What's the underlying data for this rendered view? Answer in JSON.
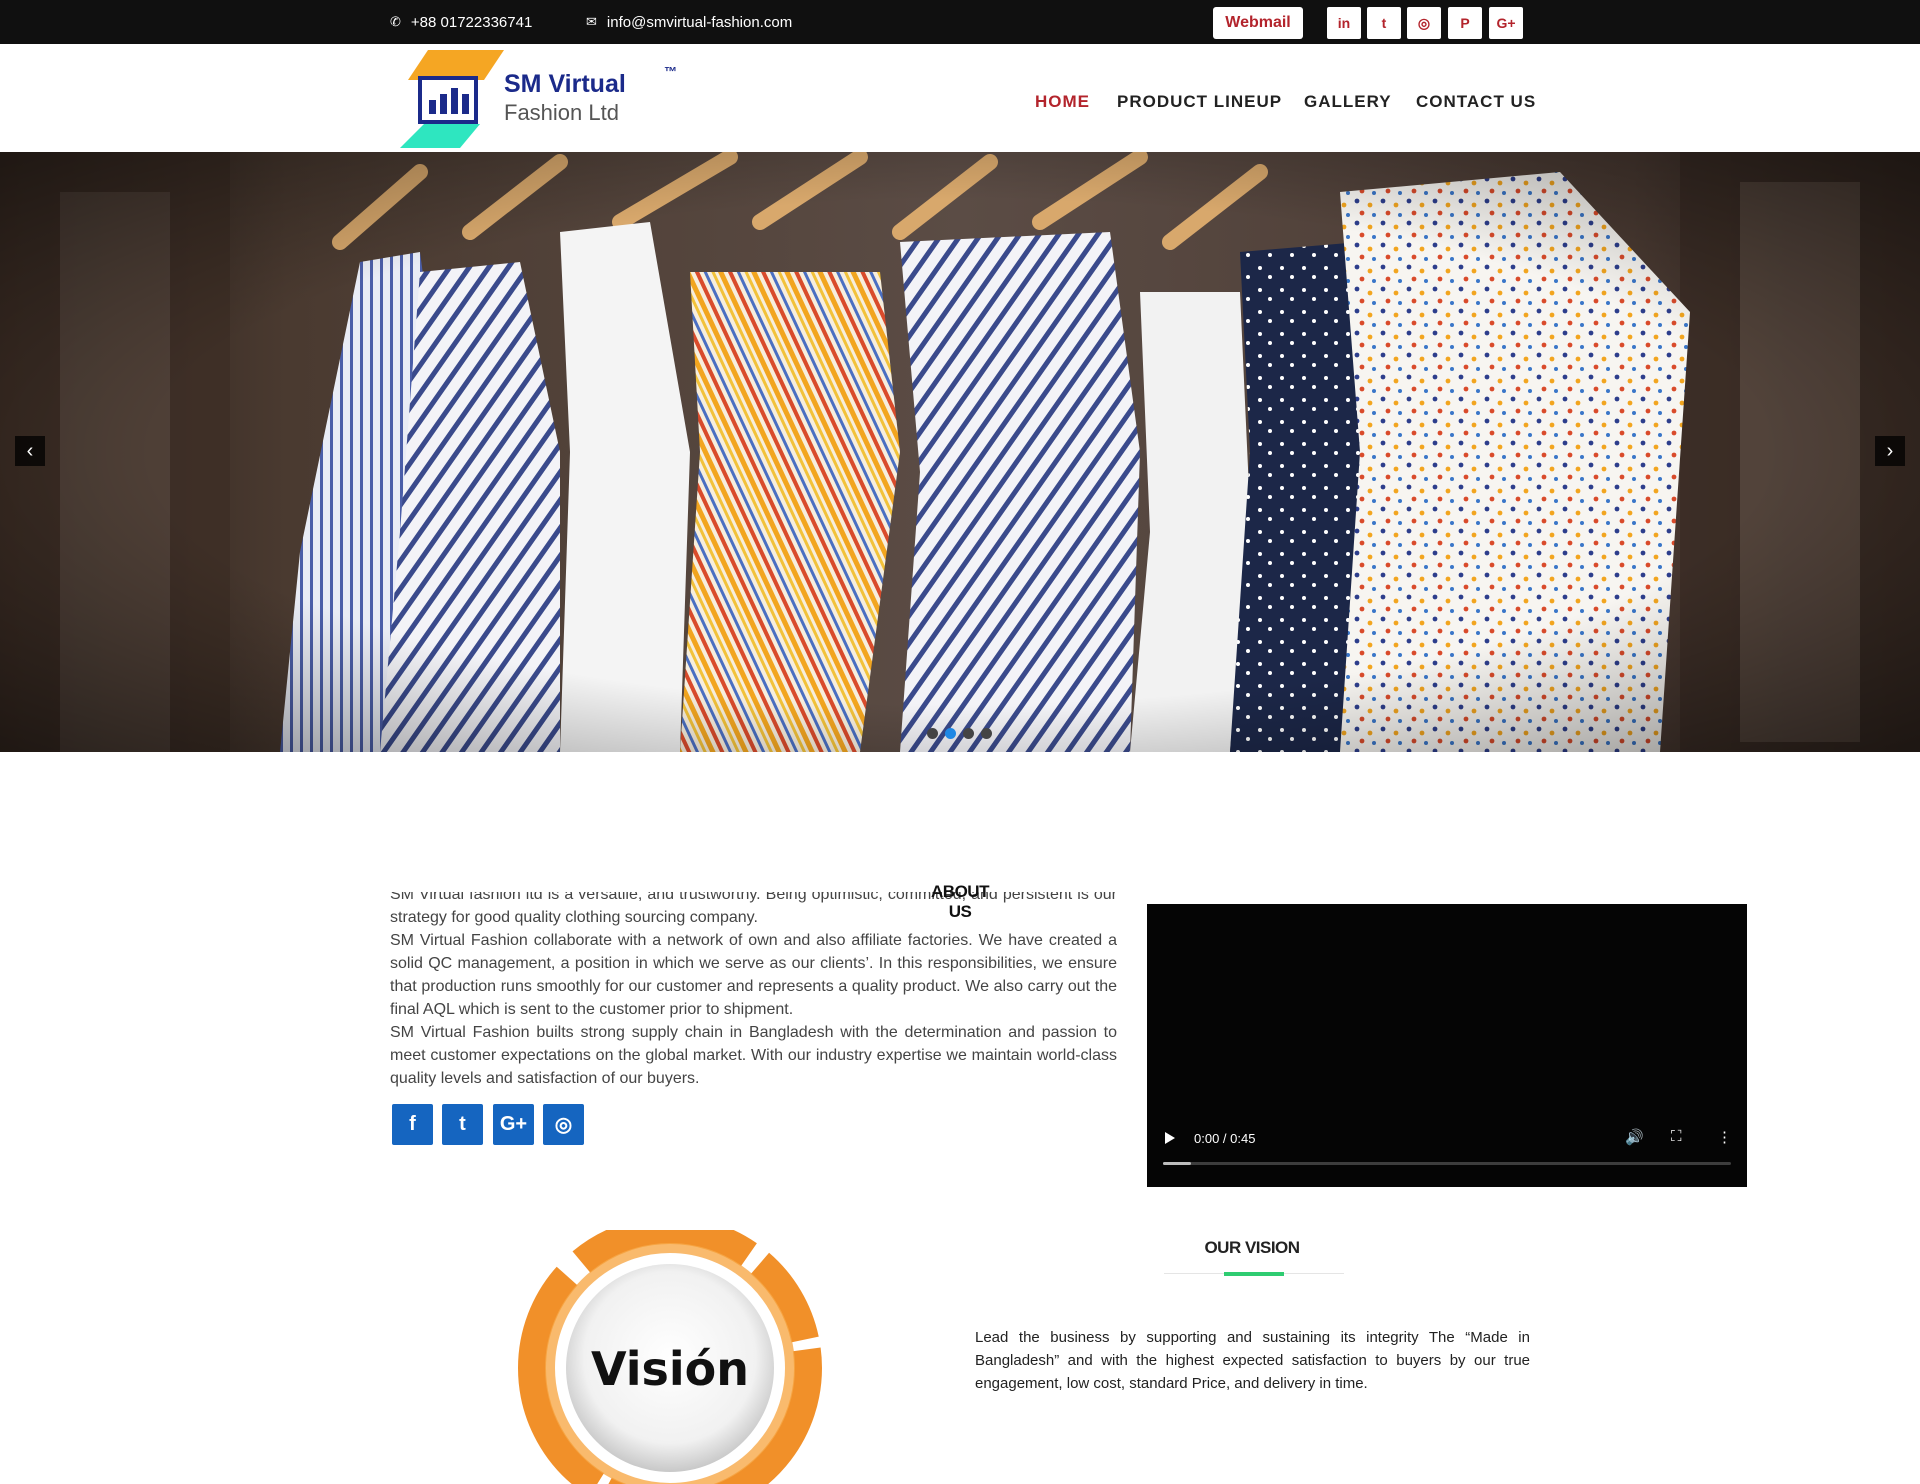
{
  "topbar": {
    "phone": "+88 01722336741",
    "email": "info@smvirtual-fashion.com",
    "webmail_label": "Webmail",
    "social": [
      {
        "name": "linkedin-icon",
        "glyph": "in"
      },
      {
        "name": "twitter-icon",
        "glyph": "t"
      },
      {
        "name": "instagram-icon",
        "glyph": "◎"
      },
      {
        "name": "pinterest-icon",
        "glyph": "P"
      },
      {
        "name": "google-plus-icon",
        "glyph": "G+"
      }
    ]
  },
  "logo": {
    "line1": "SM Virtual",
    "line2": "Fashion Ltd",
    "tm": "™"
  },
  "nav": [
    {
      "label": "HOME",
      "active": true
    },
    {
      "label": "PRODUCT LINEUP",
      "active": false
    },
    {
      "label": "GALLERY",
      "active": false
    },
    {
      "label": "CONTACT US",
      "active": false
    }
  ],
  "slider": {
    "prev": "‹",
    "next": "›",
    "dots": 4,
    "active_dot": 2
  },
  "about": {
    "title": "ABOUT US",
    "paragraphs": [
      "SM Virtual fashion ltd is a versatile, and trustworthy. Being optimistic, committed, and persistent is our strategy for good quality clothing sourcing company.",
      "SM Virtual Fashion collaborate with a network of own and also affiliate factories. We have created a solid QC management, a position in which we serve as our clients’. In this responsibilities, we ensure that production runs smoothly for our customer and represents a quality product. We also carry out the final AQL which is sent to the customer prior to shipment.",
      "SM Virtual Fashion builts strong supply chain in Bangladesh with the determination and passion to meet customer expectations on the global market. With our industry expertise we maintain world-class quality levels and satisfaction of our buyers."
    ],
    "social": [
      {
        "name": "facebook-icon",
        "glyph": "f"
      },
      {
        "name": "twitter-icon",
        "glyph": "t"
      },
      {
        "name": "google-plus-icon",
        "glyph": "G+"
      },
      {
        "name": "instagram-icon",
        "glyph": "◎"
      }
    ]
  },
  "video": {
    "time": "0:00 / 0:45",
    "progress": 0.05
  },
  "vision": {
    "title": "OUR VISION",
    "text": "Lead the business by supporting and sustaining its integrity The “Made in Bangladesh” and with the highest expected satisfaction to buyers by our true engagement, low cost, standard  Price, and delivery in time.",
    "image_word": "Visión"
  },
  "colors": {
    "accent_red": "#b3242c",
    "social_blue": "#1565c0",
    "vision_green": "#2ecc71",
    "logo_blue": "#1b2a8a",
    "logo_orange": "#f5a623",
    "logo_teal": "#2ee6c0"
  }
}
